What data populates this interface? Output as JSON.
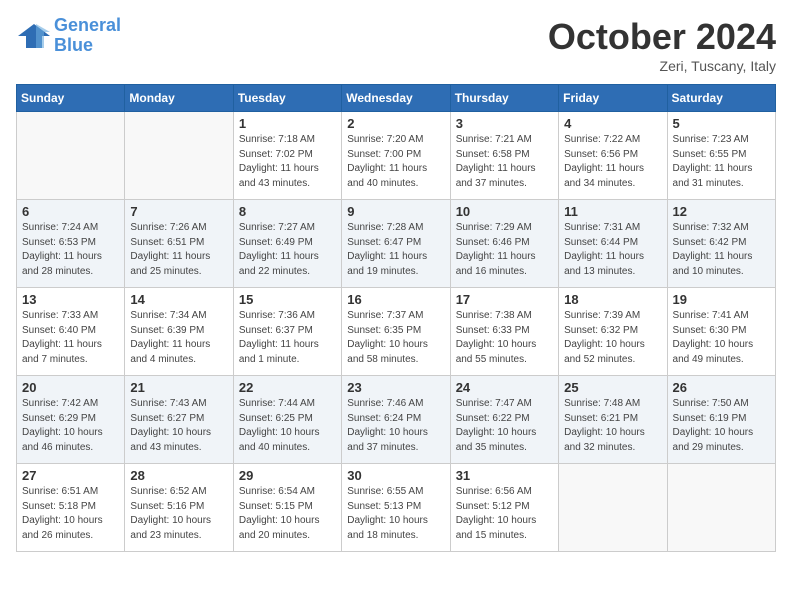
{
  "header": {
    "logo_line1": "General",
    "logo_line2": "Blue",
    "month_title": "October 2024",
    "location": "Zeri, Tuscany, Italy"
  },
  "weekdays": [
    "Sunday",
    "Monday",
    "Tuesday",
    "Wednesday",
    "Thursday",
    "Friday",
    "Saturday"
  ],
  "weeks": [
    [
      {
        "day": "",
        "sunrise": "",
        "sunset": "",
        "daylight": ""
      },
      {
        "day": "",
        "sunrise": "",
        "sunset": "",
        "daylight": ""
      },
      {
        "day": "1",
        "sunrise": "Sunrise: 7:18 AM",
        "sunset": "Sunset: 7:02 PM",
        "daylight": "Daylight: 11 hours and 43 minutes."
      },
      {
        "day": "2",
        "sunrise": "Sunrise: 7:20 AM",
        "sunset": "Sunset: 7:00 PM",
        "daylight": "Daylight: 11 hours and 40 minutes."
      },
      {
        "day": "3",
        "sunrise": "Sunrise: 7:21 AM",
        "sunset": "Sunset: 6:58 PM",
        "daylight": "Daylight: 11 hours and 37 minutes."
      },
      {
        "day": "4",
        "sunrise": "Sunrise: 7:22 AM",
        "sunset": "Sunset: 6:56 PM",
        "daylight": "Daylight: 11 hours and 34 minutes."
      },
      {
        "day": "5",
        "sunrise": "Sunrise: 7:23 AM",
        "sunset": "Sunset: 6:55 PM",
        "daylight": "Daylight: 11 hours and 31 minutes."
      }
    ],
    [
      {
        "day": "6",
        "sunrise": "Sunrise: 7:24 AM",
        "sunset": "Sunset: 6:53 PM",
        "daylight": "Daylight: 11 hours and 28 minutes."
      },
      {
        "day": "7",
        "sunrise": "Sunrise: 7:26 AM",
        "sunset": "Sunset: 6:51 PM",
        "daylight": "Daylight: 11 hours and 25 minutes."
      },
      {
        "day": "8",
        "sunrise": "Sunrise: 7:27 AM",
        "sunset": "Sunset: 6:49 PM",
        "daylight": "Daylight: 11 hours and 22 minutes."
      },
      {
        "day": "9",
        "sunrise": "Sunrise: 7:28 AM",
        "sunset": "Sunset: 6:47 PM",
        "daylight": "Daylight: 11 hours and 19 minutes."
      },
      {
        "day": "10",
        "sunrise": "Sunrise: 7:29 AM",
        "sunset": "Sunset: 6:46 PM",
        "daylight": "Daylight: 11 hours and 16 minutes."
      },
      {
        "day": "11",
        "sunrise": "Sunrise: 7:31 AM",
        "sunset": "Sunset: 6:44 PM",
        "daylight": "Daylight: 11 hours and 13 minutes."
      },
      {
        "day": "12",
        "sunrise": "Sunrise: 7:32 AM",
        "sunset": "Sunset: 6:42 PM",
        "daylight": "Daylight: 11 hours and 10 minutes."
      }
    ],
    [
      {
        "day": "13",
        "sunrise": "Sunrise: 7:33 AM",
        "sunset": "Sunset: 6:40 PM",
        "daylight": "Daylight: 11 hours and 7 minutes."
      },
      {
        "day": "14",
        "sunrise": "Sunrise: 7:34 AM",
        "sunset": "Sunset: 6:39 PM",
        "daylight": "Daylight: 11 hours and 4 minutes."
      },
      {
        "day": "15",
        "sunrise": "Sunrise: 7:36 AM",
        "sunset": "Sunset: 6:37 PM",
        "daylight": "Daylight: 11 hours and 1 minute."
      },
      {
        "day": "16",
        "sunrise": "Sunrise: 7:37 AM",
        "sunset": "Sunset: 6:35 PM",
        "daylight": "Daylight: 10 hours and 58 minutes."
      },
      {
        "day": "17",
        "sunrise": "Sunrise: 7:38 AM",
        "sunset": "Sunset: 6:33 PM",
        "daylight": "Daylight: 10 hours and 55 minutes."
      },
      {
        "day": "18",
        "sunrise": "Sunrise: 7:39 AM",
        "sunset": "Sunset: 6:32 PM",
        "daylight": "Daylight: 10 hours and 52 minutes."
      },
      {
        "day": "19",
        "sunrise": "Sunrise: 7:41 AM",
        "sunset": "Sunset: 6:30 PM",
        "daylight": "Daylight: 10 hours and 49 minutes."
      }
    ],
    [
      {
        "day": "20",
        "sunrise": "Sunrise: 7:42 AM",
        "sunset": "Sunset: 6:29 PM",
        "daylight": "Daylight: 10 hours and 46 minutes."
      },
      {
        "day": "21",
        "sunrise": "Sunrise: 7:43 AM",
        "sunset": "Sunset: 6:27 PM",
        "daylight": "Daylight: 10 hours and 43 minutes."
      },
      {
        "day": "22",
        "sunrise": "Sunrise: 7:44 AM",
        "sunset": "Sunset: 6:25 PM",
        "daylight": "Daylight: 10 hours and 40 minutes."
      },
      {
        "day": "23",
        "sunrise": "Sunrise: 7:46 AM",
        "sunset": "Sunset: 6:24 PM",
        "daylight": "Daylight: 10 hours and 37 minutes."
      },
      {
        "day": "24",
        "sunrise": "Sunrise: 7:47 AM",
        "sunset": "Sunset: 6:22 PM",
        "daylight": "Daylight: 10 hours and 35 minutes."
      },
      {
        "day": "25",
        "sunrise": "Sunrise: 7:48 AM",
        "sunset": "Sunset: 6:21 PM",
        "daylight": "Daylight: 10 hours and 32 minutes."
      },
      {
        "day": "26",
        "sunrise": "Sunrise: 7:50 AM",
        "sunset": "Sunset: 6:19 PM",
        "daylight": "Daylight: 10 hours and 29 minutes."
      }
    ],
    [
      {
        "day": "27",
        "sunrise": "Sunrise: 6:51 AM",
        "sunset": "Sunset: 5:18 PM",
        "daylight": "Daylight: 10 hours and 26 minutes."
      },
      {
        "day": "28",
        "sunrise": "Sunrise: 6:52 AM",
        "sunset": "Sunset: 5:16 PM",
        "daylight": "Daylight: 10 hours and 23 minutes."
      },
      {
        "day": "29",
        "sunrise": "Sunrise: 6:54 AM",
        "sunset": "Sunset: 5:15 PM",
        "daylight": "Daylight: 10 hours and 20 minutes."
      },
      {
        "day": "30",
        "sunrise": "Sunrise: 6:55 AM",
        "sunset": "Sunset: 5:13 PM",
        "daylight": "Daylight: 10 hours and 18 minutes."
      },
      {
        "day": "31",
        "sunrise": "Sunrise: 6:56 AM",
        "sunset": "Sunset: 5:12 PM",
        "daylight": "Daylight: 10 hours and 15 minutes."
      },
      {
        "day": "",
        "sunrise": "",
        "sunset": "",
        "daylight": ""
      },
      {
        "day": "",
        "sunrise": "",
        "sunset": "",
        "daylight": ""
      }
    ]
  ]
}
